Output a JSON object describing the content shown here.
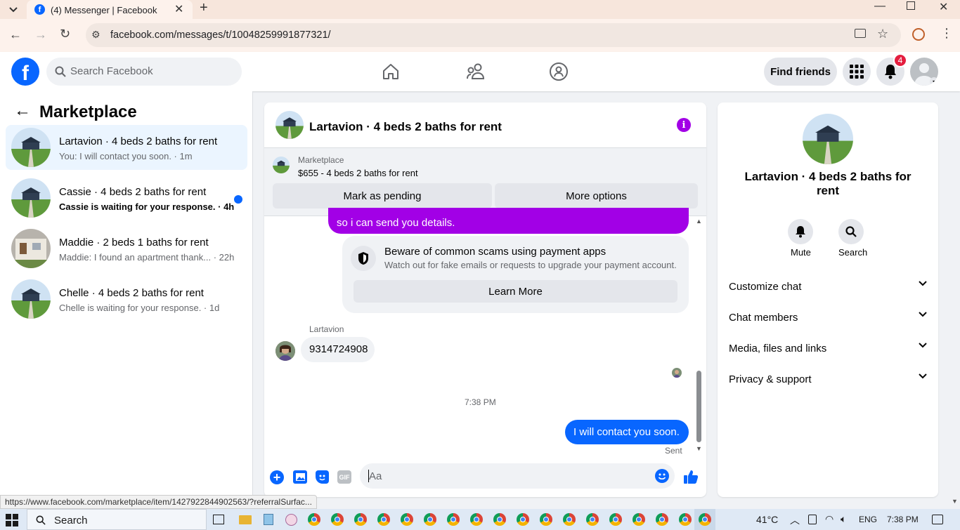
{
  "browser": {
    "tab_title": "(4) Messenger | Facebook",
    "url": "facebook.com/messages/t/10048259991877321/"
  },
  "header": {
    "search_placeholder": "Search Facebook",
    "find_friends": "Find friends",
    "notification_count": "4",
    "accent": "#0866ff"
  },
  "sidebar": {
    "title": "Marketplace",
    "conversations": [
      {
        "title": "Lartavion · 4 beds 2 baths for rent",
        "preview": "You: I will contact you soon. · 1m",
        "selected": true,
        "unread": false
      },
      {
        "title": "Cassie · 4 beds 2 baths for rent",
        "preview": "Cassie is waiting for your response. · 4h",
        "selected": false,
        "unread": true
      },
      {
        "title": "Maddie · 2 beds 1 baths for rent",
        "preview": "Maddie: I found an apartment thank... · 22h",
        "selected": false,
        "unread": false
      },
      {
        "title": "Chelle · 4 beds 2 baths for rent",
        "preview": "Chelle is waiting for your response. · 1d",
        "selected": false,
        "unread": false
      }
    ]
  },
  "chat": {
    "title": "Lartavion · 4 beds 2 baths for rent",
    "listing_label": "Marketplace",
    "listing_price": "$655 - 4 beds 2 baths for rent",
    "mark_pending": "Mark as pending",
    "more_options": "More options",
    "partial_message": "so i can send you details.",
    "scam_title": "Beware of common scams using payment apps",
    "scam_body": "Watch out for fake emails or requests to upgrade your payment account.",
    "learn_more": "Learn More",
    "sender_name": "Lartavion",
    "received_message": "9314724908",
    "timestamp": "7:38 PM",
    "sent_message": "I will contact you soon.",
    "sent_status": "Sent",
    "composer_placeholder": "Aa",
    "gif_label": "GIF",
    "outgoing_color": "#0866ff",
    "system_color": "#a200e6"
  },
  "details": {
    "title": "Lartavion · 4 beds 2 baths for rent",
    "mute": "Mute",
    "search": "Search",
    "sections": [
      "Customize chat",
      "Chat members",
      "Media, files and links",
      "Privacy & support"
    ]
  },
  "status_url": "https://www.facebook.com/marketplace/item/1427922844902563/?referralSurfac...",
  "taskbar": {
    "search": "Search",
    "temperature": "41°C",
    "language": "ENG",
    "time": "7:38 PM"
  }
}
